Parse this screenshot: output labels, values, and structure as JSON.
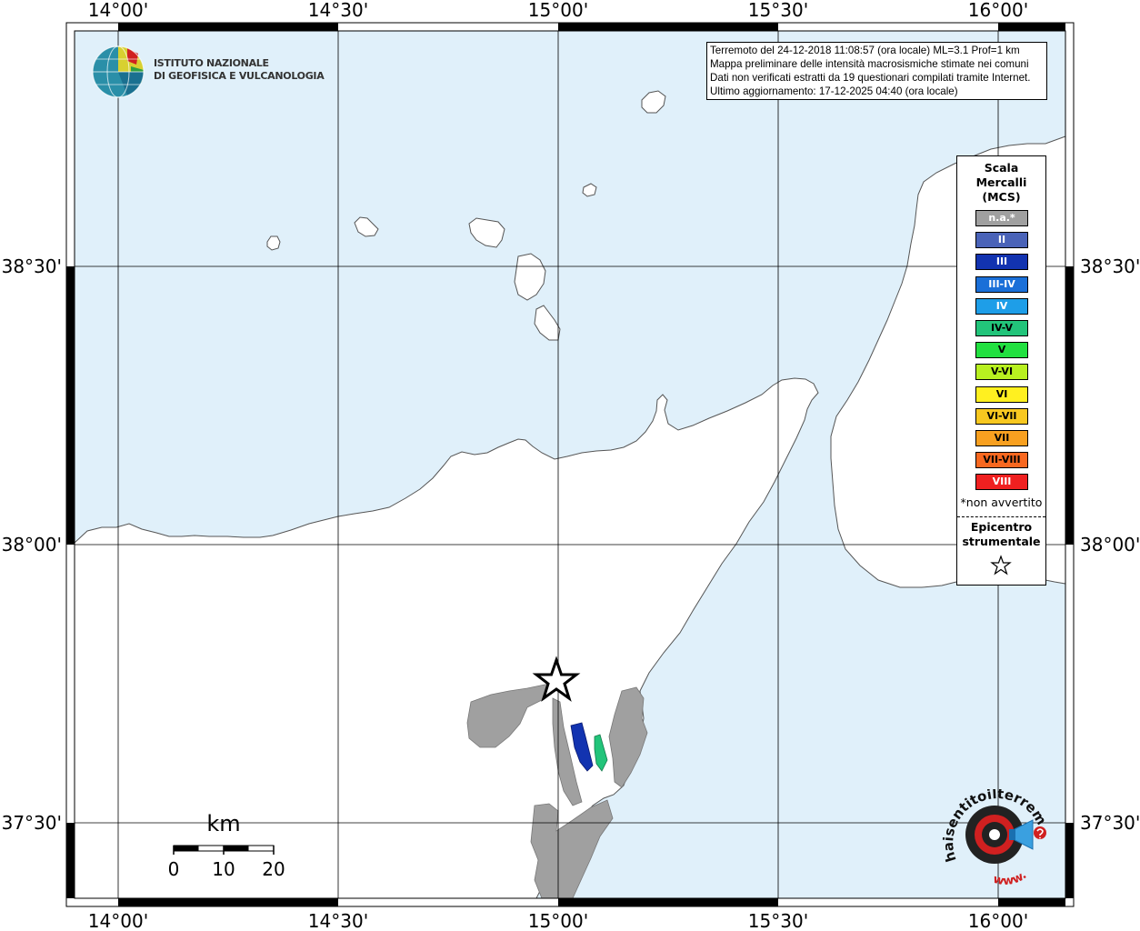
{
  "info": {
    "line1": "Terremoto del 24-12-2018 11:08:57 (ora locale) ML=3.1 Prof=1 km",
    "line2": "Mappa preliminare delle intensità macrosismiche stimate nei comuni",
    "line3": "Dati non verificati estratti da 19 questionari compilati tramite Internet.",
    "line4": "Ultimo aggiornamento: 17-12-2025 04:40 (ora locale)"
  },
  "axes": {
    "lon_labels": [
      "14°00'",
      "14°30'",
      "15°00'",
      "15°30'",
      "16°00'"
    ],
    "lat_labels": [
      "38°30'",
      "38°00'",
      "37°30'"
    ]
  },
  "logo": {
    "line1": "ISTITUTO NAZIONALE",
    "line2": "DI GEOFISICA E VULCANOLOGIA"
  },
  "legend": {
    "title1": "Scala",
    "title2": "Mercalli",
    "title3": "(MCS)",
    "items": [
      {
        "label": "n.a.*",
        "color": "#a0a0a0",
        "text_color": "#ffffff"
      },
      {
        "label": "II",
        "color": "#4a63b8",
        "text_color": "#ffffff"
      },
      {
        "label": "III",
        "color": "#1233b0",
        "text_color": "#ffffff"
      },
      {
        "label": "III-IV",
        "color": "#1a6fd8",
        "text_color": "#ffffff"
      },
      {
        "label": "IV",
        "color": "#1e9ee8",
        "text_color": "#ffffff"
      },
      {
        "label": "IV-V",
        "color": "#22c47a",
        "text_color": "#000000"
      },
      {
        "label": "V",
        "color": "#22e040",
        "text_color": "#000000"
      },
      {
        "label": "V-VI",
        "color": "#b8f020",
        "text_color": "#000000"
      },
      {
        "label": "VI",
        "color": "#fff020",
        "text_color": "#000000"
      },
      {
        "label": "VI-VII",
        "color": "#f8c820",
        "text_color": "#000000"
      },
      {
        "label": "VII",
        "color": "#f8a020",
        "text_color": "#000000"
      },
      {
        "label": "VII-VIII",
        "color": "#f86820",
        "text_color": "#000000"
      },
      {
        "label": "VIII",
        "color": "#f02020",
        "text_color": "#ffffff"
      }
    ],
    "note": "*non avvertito",
    "epicentre1": "Epicentro",
    "epicentre2": "strumentale"
  },
  "scale_bar": {
    "unit": "km",
    "ticks": [
      "0",
      "10",
      "20"
    ]
  },
  "colors": {
    "sea": "#e0f0fa",
    "land": "#ffffff",
    "not_available": "#a0a0a0",
    "intensity_III": "#1233b0",
    "intensity_IV_V": "#22c47a"
  },
  "brand": {
    "site_main": "haisentitoilterremoto.it",
    "site_www": "www."
  }
}
